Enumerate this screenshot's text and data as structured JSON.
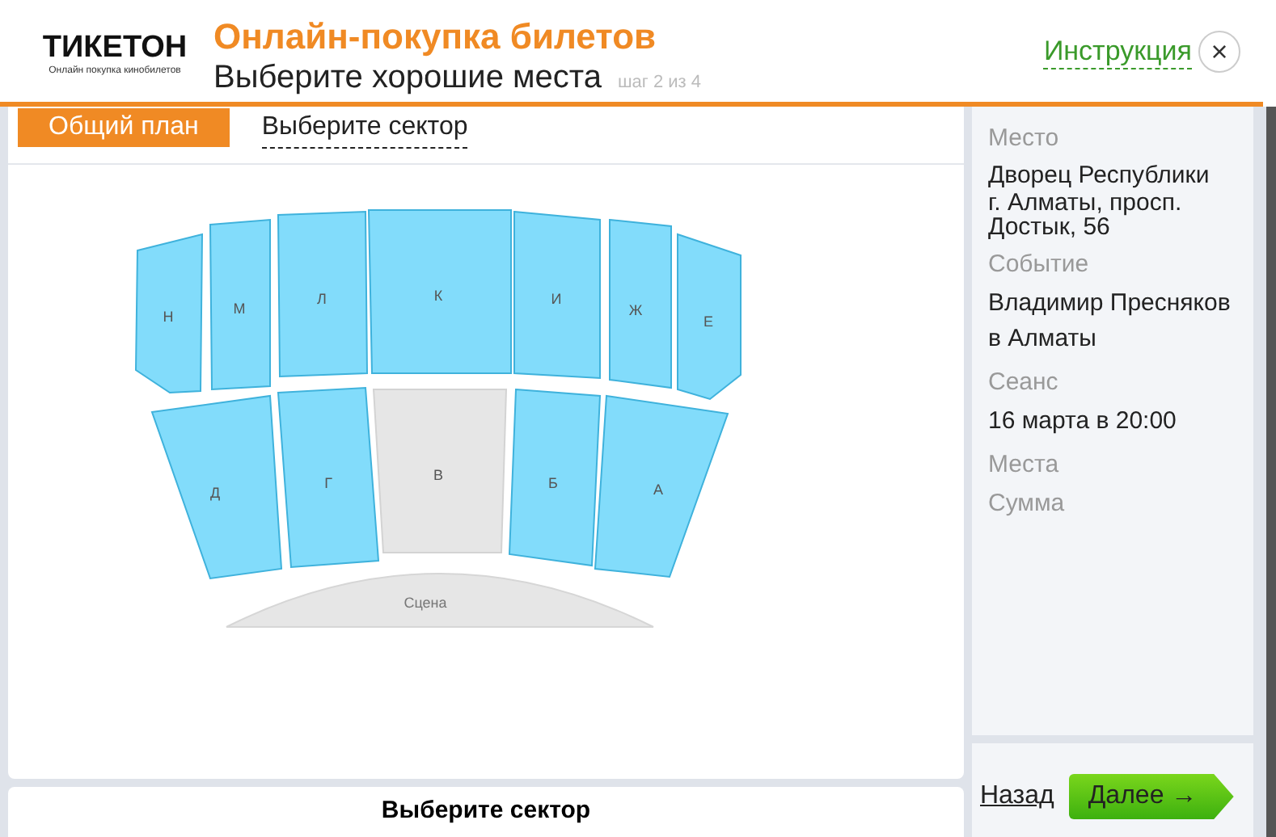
{
  "logo": {
    "name": "ТИКЕТОН",
    "tagline": "Онлайн покупка кинобилетов"
  },
  "header": {
    "title": "Онлайн-покупка билетов",
    "subtitle": "Выберите хорошие места",
    "step": "шаг 2 из 4",
    "help_link": "Инструкция",
    "close": "×"
  },
  "tabs": [
    {
      "label": "Общий план",
      "selected": true
    },
    {
      "label": "Выберите сектор",
      "selected": false
    }
  ],
  "sectors": [
    {
      "label": "Н",
      "available": true
    },
    {
      "label": "М",
      "available": true
    },
    {
      "label": "Л",
      "available": true
    },
    {
      "label": "К",
      "available": true
    },
    {
      "label": "И",
      "available": true
    },
    {
      "label": "Ж",
      "available": true
    },
    {
      "label": "Е",
      "available": true
    },
    {
      "label": "Д",
      "available": true
    },
    {
      "label": "Г",
      "available": true
    },
    {
      "label": "В",
      "available": false
    },
    {
      "label": "Б",
      "available": true
    },
    {
      "label": "А",
      "available": true
    }
  ],
  "stage": "Сцена",
  "sector_prompt": "Выберите сектор",
  "sidebar": [
    {
      "label": "Место",
      "value": "Дворец Республики",
      "detail": "г. Алматы, просп. Достык, 56"
    },
    {
      "label": "Событие",
      "value": "Владимир Пресняков в Алматы"
    },
    {
      "label": "Сеанс",
      "value": "16 марта в 20:00"
    },
    {
      "label": "Места"
    },
    {
      "label": "Сумма"
    }
  ],
  "back_link": "Назад",
  "next_button": "Далее →"
}
